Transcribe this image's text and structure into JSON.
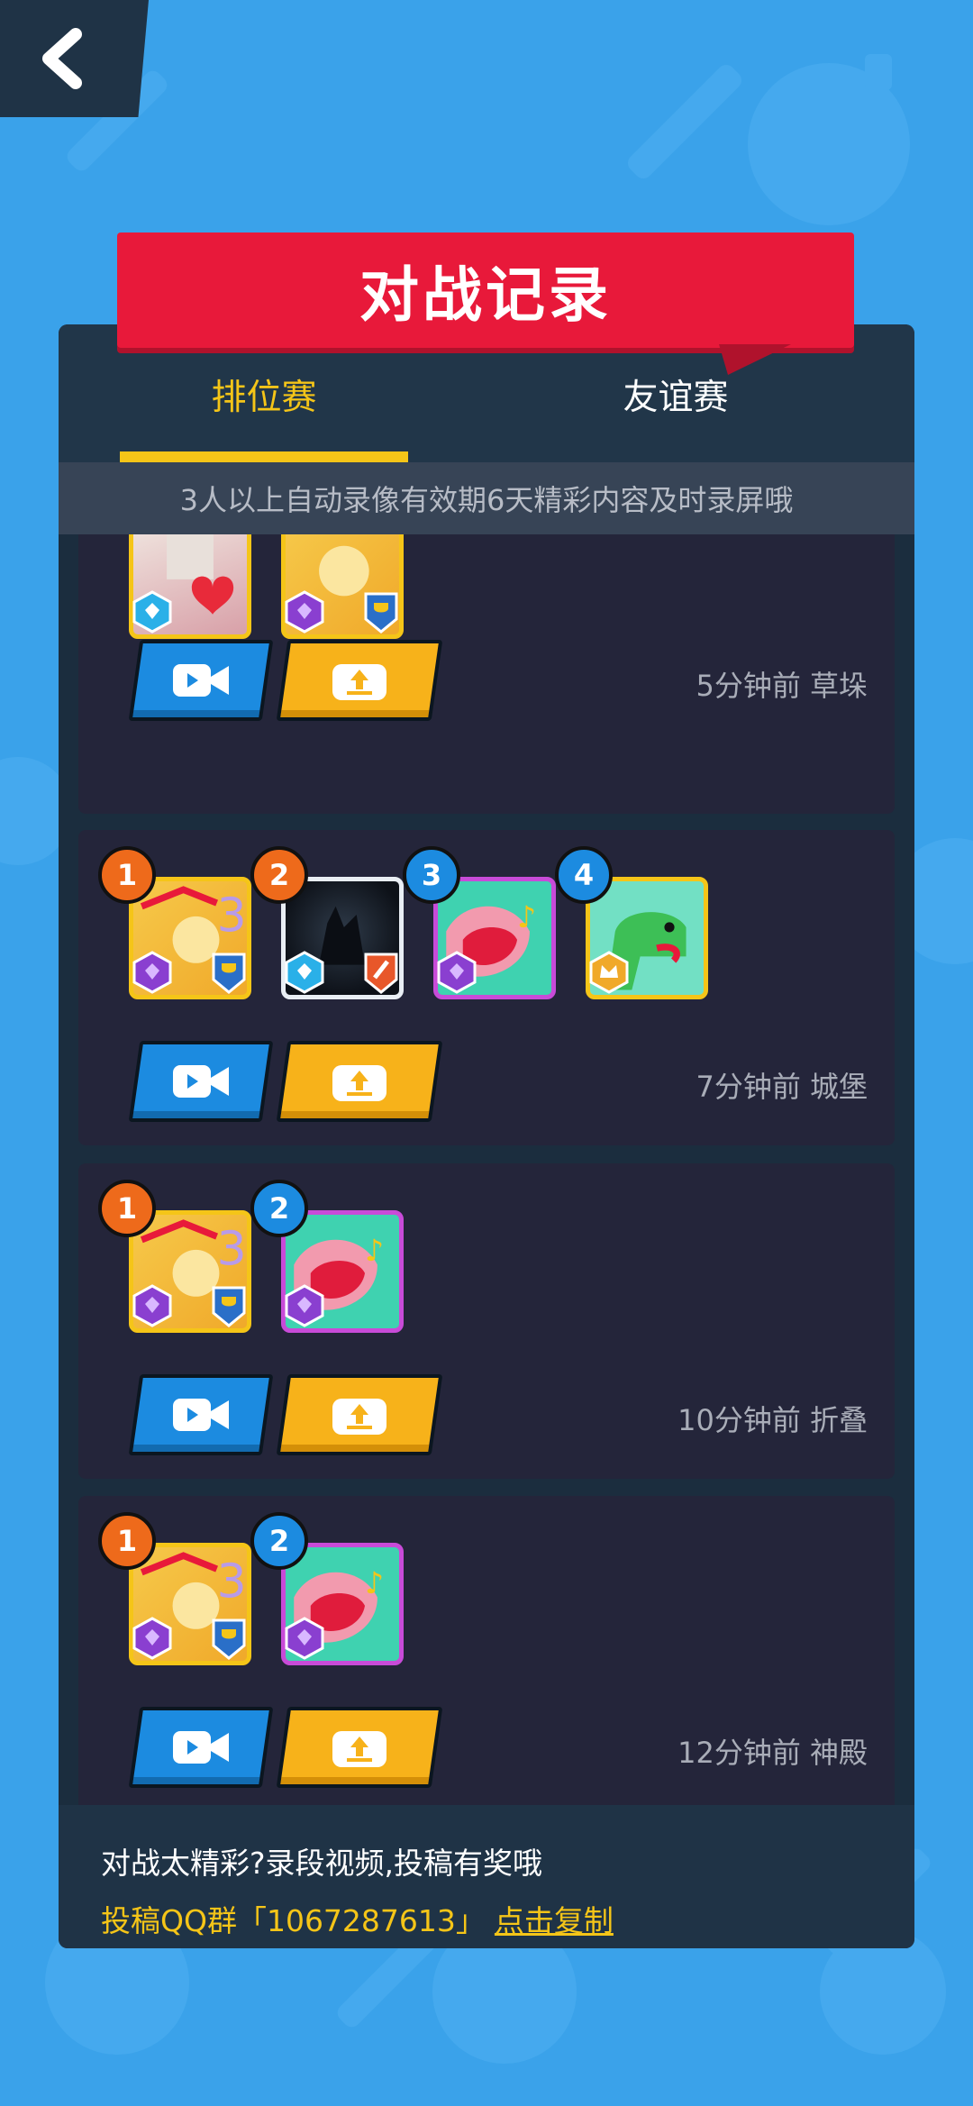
{
  "title": "对战记录",
  "tabs": [
    {
      "label": "排位赛",
      "active": true
    },
    {
      "label": "友谊赛",
      "active": false
    }
  ],
  "notice": "3人以上自动录像有效期6天精彩内容及时录屏哦",
  "records": [
    {
      "meta": "5分钟前 草垛",
      "players": [
        {
          "avatar": "photo-heart"
        },
        {
          "avatar": "gold-balloon"
        }
      ]
    },
    {
      "meta": "7分钟前 城堡",
      "players": [
        {
          "rank": "1",
          "avatar": "gold-balloon"
        },
        {
          "rank": "2",
          "avatar": "black-wolf"
        },
        {
          "rank": "3",
          "avatar": "pink-mouth-music"
        },
        {
          "rank": "4",
          "avatar": "green-dino"
        }
      ]
    },
    {
      "meta": "10分钟前 折叠",
      "players": [
        {
          "rank": "1",
          "avatar": "gold-balloon"
        },
        {
          "rank": "2",
          "avatar": "pink-mouth-music"
        }
      ]
    },
    {
      "meta": "12分钟前 神殿",
      "players": [
        {
          "rank": "1",
          "avatar": "gold-balloon"
        },
        {
          "rank": "2",
          "avatar": "pink-mouth-music"
        }
      ]
    }
  ],
  "footer": {
    "line1": "对战太精彩?录段视频,投稿有奖哦",
    "line2_prefix": "投稿QQ群「1067287613」",
    "copy_label": "点击复制"
  },
  "icons": {
    "back": "chevron-left-icon",
    "video": "video-camera-icon",
    "share": "upload-icon"
  },
  "colors": {
    "background": "#3aa2ea",
    "title_banner": "#e8193a",
    "active_tab": "#f5c518",
    "video_button": "#1c8be0",
    "share_button": "#f7b21a",
    "rank_first": "#ee6a1b",
    "rank_other": "#1c8be0"
  }
}
